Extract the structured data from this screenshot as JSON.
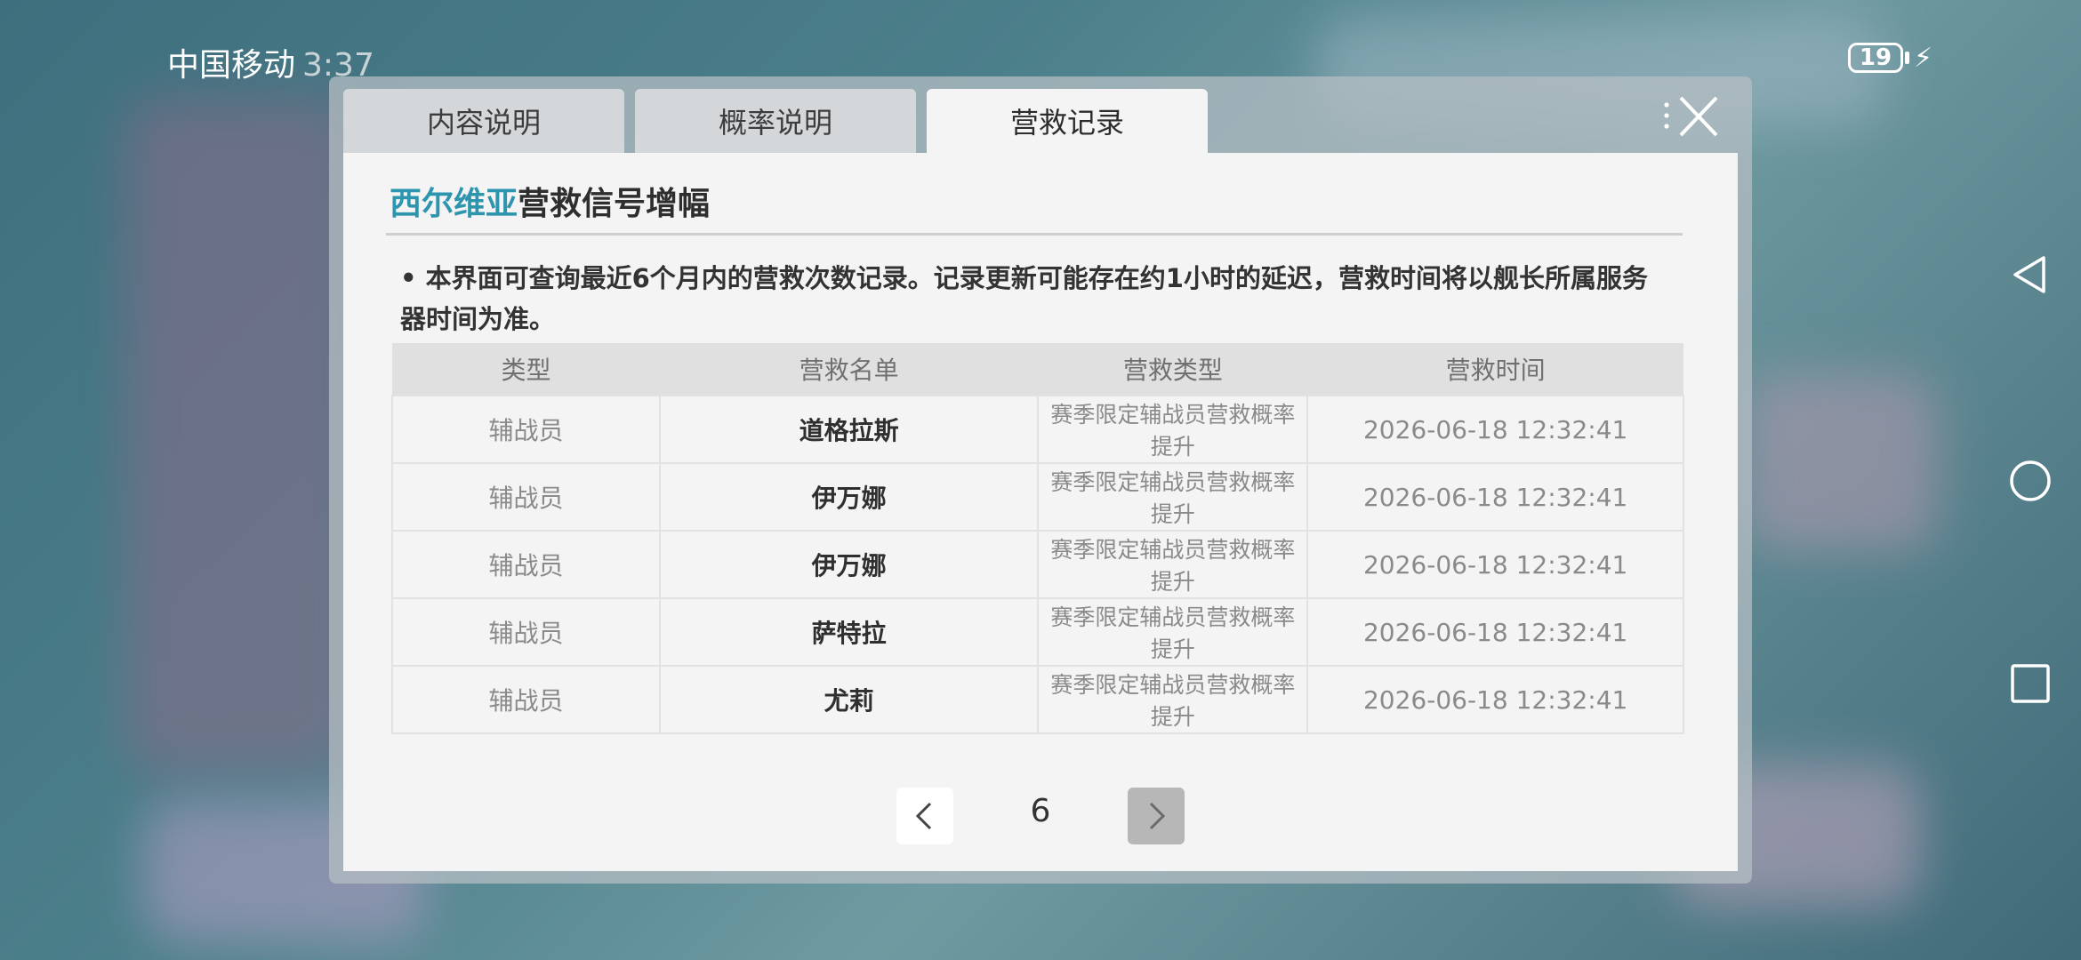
{
  "status": {
    "carrier": "中国移动",
    "time": "3:37",
    "battery": "19"
  },
  "tabs": [
    {
      "label": "内容说明",
      "active": false
    },
    {
      "label": "概率说明",
      "active": false
    },
    {
      "label": "营救记录",
      "active": true
    }
  ],
  "panel": {
    "title_highlight": "西尔维亚",
    "title_rest": "营救信号增幅",
    "notice": "• 本界面可查询最近6个月内的营救次数记录。记录更新可能存在约1小时的延迟，营救时间将以舰长所属服务器时间为准。"
  },
  "table": {
    "headers": [
      "类型",
      "营救名单",
      "营救类型",
      "营救时间"
    ],
    "rows": [
      [
        "辅战员",
        "道格拉斯",
        "赛季限定辅战员营救概率提升",
        "2026-06-18 12:32:41"
      ],
      [
        "辅战员",
        "伊万娜",
        "赛季限定辅战员营救概率提升",
        "2026-06-18 12:32:41"
      ],
      [
        "辅战员",
        "伊万娜",
        "赛季限定辅战员营救概率提升",
        "2026-06-18 12:32:41"
      ],
      [
        "辅战员",
        "萨特拉",
        "赛季限定辅战员营救概率提升",
        "2026-06-18 12:32:41"
      ],
      [
        "辅战员",
        "尤莉",
        "赛季限定辅战员营救概率提升",
        "2026-06-18 12:32:41"
      ]
    ]
  },
  "pager": {
    "page": "6"
  },
  "colors": {
    "accent": "#2d95ad",
    "panel_bg": "#f4f4f4",
    "tab_inactive": "#d4d7da"
  }
}
